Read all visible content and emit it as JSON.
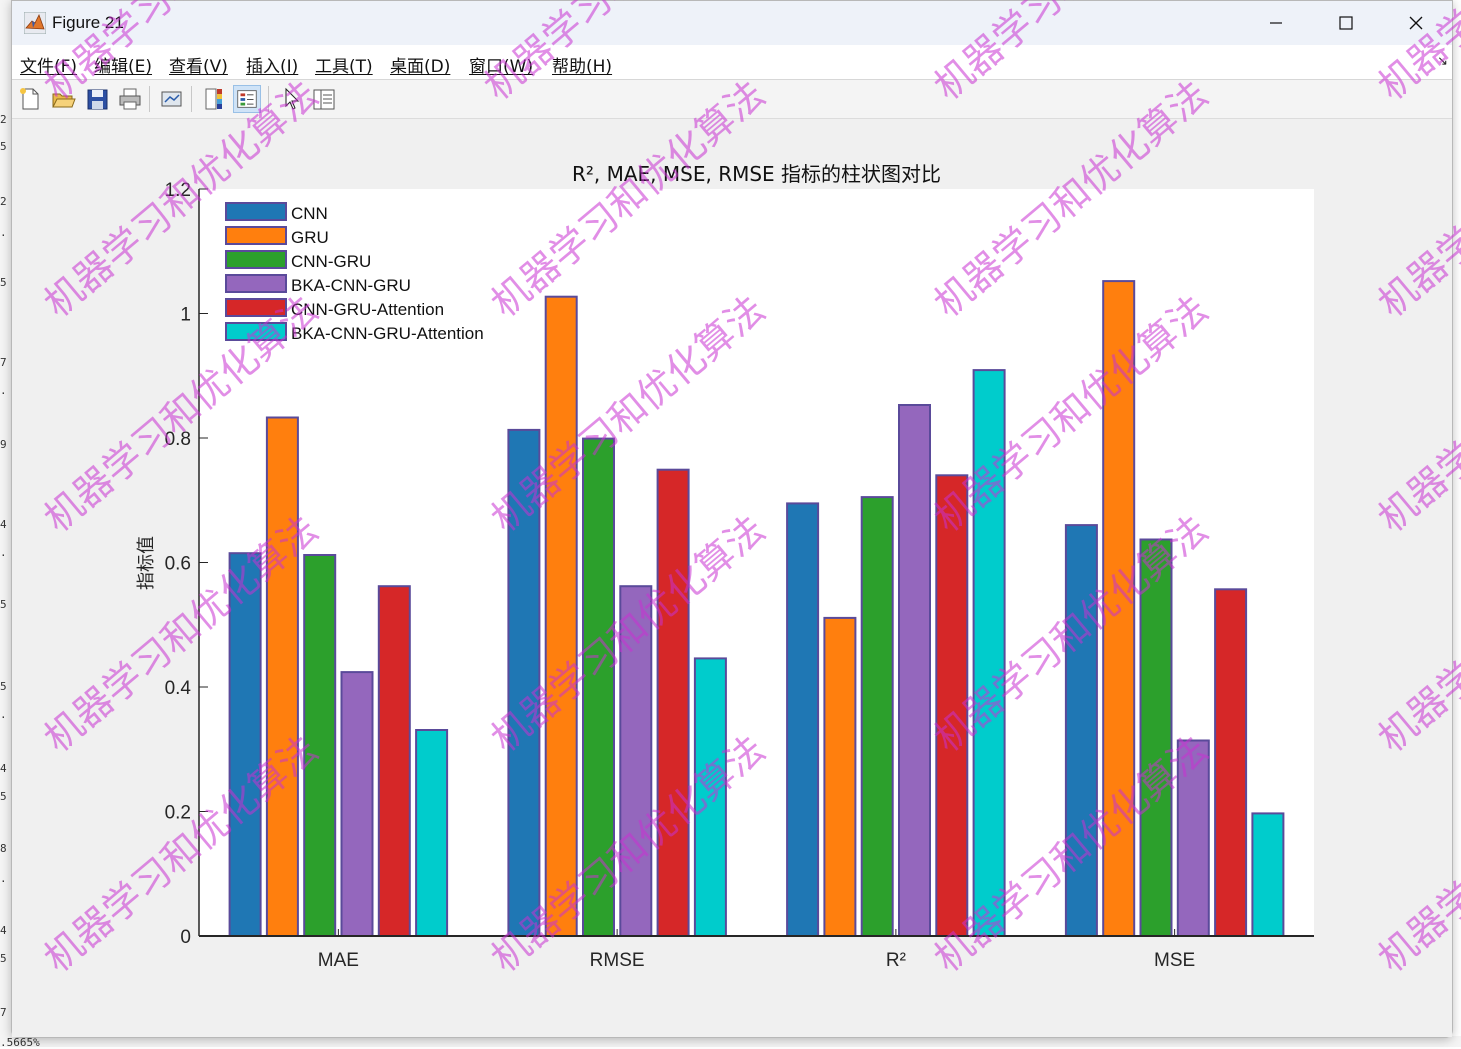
{
  "window": {
    "title": "Figure 21",
    "minimize_label": "—",
    "maximize_label": "□",
    "close_label": "✕"
  },
  "menu": [
    {
      "label": "文件(F)"
    },
    {
      "label": "编辑(E)"
    },
    {
      "label": "查看(V)"
    },
    {
      "label": "插入(I)"
    },
    {
      "label": "工具(T)"
    },
    {
      "label": "桌面(D)"
    },
    {
      "label": "窗口(W)"
    },
    {
      "label": "帮助(H)"
    }
  ],
  "menu_overflow_icon": "dock-arrow-icon",
  "toolbar": [
    {
      "name": "new-figure-icon"
    },
    {
      "name": "open-file-icon"
    },
    {
      "name": "save-icon"
    },
    {
      "name": "print-icon"
    },
    {
      "name": "link-plot-icon"
    },
    {
      "name": "insert-colorbar-icon"
    },
    {
      "name": "insert-legend-icon"
    },
    {
      "name": "edit-plot-pointer-icon"
    },
    {
      "name": "property-inspector-icon"
    }
  ],
  "background_text": {
    "left_strip": [
      "2",
      "5",
      "2",
      ".",
      "5",
      "7",
      ".",
      "9",
      "4",
      ".",
      "5",
      "5",
      ".",
      "4",
      "5",
      "8",
      ".",
      "4",
      "5",
      "7"
    ],
    "bottom": ".5665%"
  },
  "watermark_text": "机器学习和优化算法",
  "chart_data": {
    "type": "bar",
    "title": "R², MAE, MSE, RMSE 指标的柱状图对比",
    "xlabel": "",
    "ylabel": "指标值",
    "categories": [
      "MAE",
      "RMSE",
      "R²",
      "MSE"
    ],
    "ylim": [
      0,
      1.2
    ],
    "yticks": [
      "0",
      "0.2",
      "0.4",
      "0.6",
      "0.8",
      "1",
      "1.2"
    ],
    "grid": false,
    "legend_position": "top-left",
    "bar_edge_color": "#5a4a9a",
    "series": [
      {
        "name": "CNN",
        "color": "#1f77b4",
        "values": [
          0.615,
          0.813,
          0.695,
          0.66
        ]
      },
      {
        "name": "GRU",
        "color": "#ff7f0e",
        "values": [
          0.833,
          1.027,
          0.511,
          1.052
        ]
      },
      {
        "name": "CNN-GRU",
        "color": "#2ca02c",
        "values": [
          0.612,
          0.799,
          0.705,
          0.637
        ]
      },
      {
        "name": "BKA-CNN-GRU",
        "color": "#9467bd",
        "values": [
          0.424,
          0.562,
          0.853,
          0.314
        ]
      },
      {
        "name": "CNN-GRU-Attention",
        "color": "#d62728",
        "values": [
          0.562,
          0.749,
          0.74,
          0.557
        ]
      },
      {
        "name": "BKA-CNN-GRU-Attention",
        "color": "#00cccc",
        "values": [
          0.331,
          0.446,
          0.909,
          0.197
        ]
      }
    ]
  }
}
